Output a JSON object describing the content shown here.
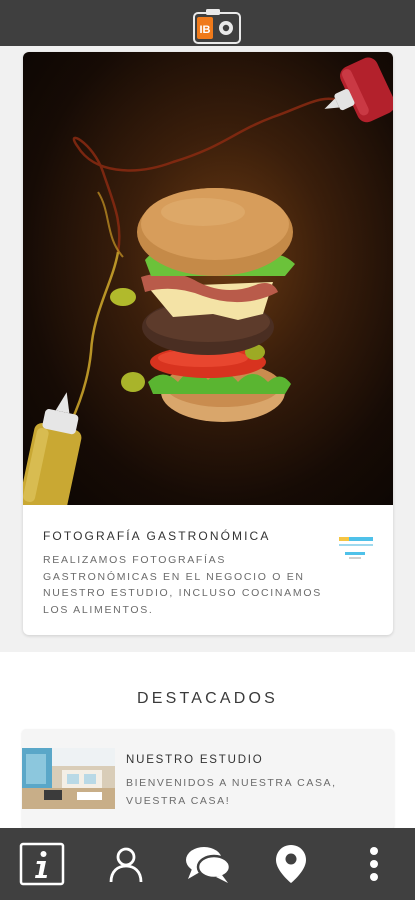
{
  "header": {
    "logo_icon": "camera-logo-icon",
    "logo_text": "IB"
  },
  "feature": {
    "title": "Fotografía gastronómica",
    "description": "Realizamos fotografías gastronómicas en el negocio o en nuestro estudio, incluso cocinamos los alimentos.",
    "image_icon": "burger-photo",
    "brand_icon": "brand-logo-icon"
  },
  "featured": {
    "heading": "DESTACADOS",
    "items": [
      {
        "title": "Nuestro estudio",
        "description": "Bienvenidos a nuestra casa, vuestra casa!",
        "thumb_icon": "studio-photo"
      }
    ]
  },
  "nav": {
    "items": [
      {
        "name": "info",
        "icon": "info-icon"
      },
      {
        "name": "profile",
        "icon": "user-icon"
      },
      {
        "name": "chat",
        "icon": "chat-icon"
      },
      {
        "name": "location",
        "icon": "location-pin-icon"
      },
      {
        "name": "more",
        "icon": "more-vertical-icon"
      }
    ]
  },
  "colors": {
    "topbar": "#3f3f3f",
    "bottom_nav": "#404040",
    "logo_orange": "#f07a1a",
    "text_dark": "#333333",
    "text_muted": "#6b6b6b"
  }
}
